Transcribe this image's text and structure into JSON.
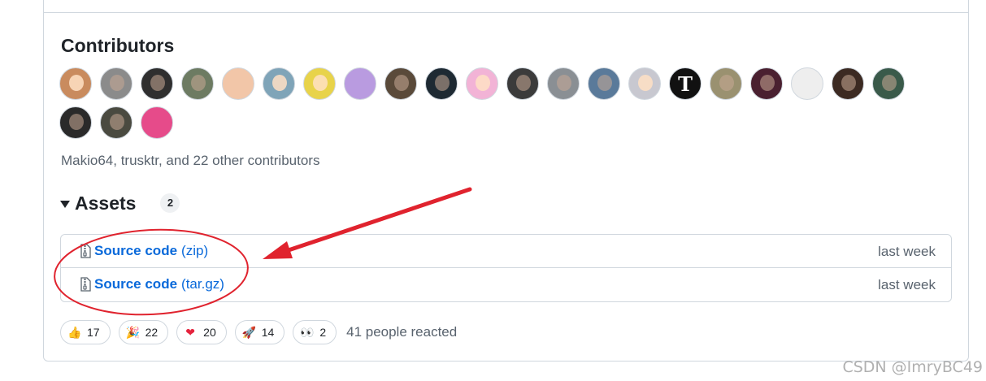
{
  "contributors": {
    "title": "Contributors",
    "summary": "Makio64, trusktr, and 22 other contributors",
    "avatars": [
      {
        "color": "#c98b5e",
        "style": "light"
      },
      {
        "color": "#8b8b8b",
        "style": "dark"
      },
      {
        "color": "#2f2f2f",
        "style": "dark"
      },
      {
        "color": "#6d7b62",
        "style": "dark"
      },
      {
        "color": "#f2c6a8",
        "style": "logo"
      },
      {
        "color": "#7fa4b8",
        "style": "light"
      },
      {
        "color": "#e8d34a",
        "style": "light"
      },
      {
        "color": "#b99be0",
        "style": "logo"
      },
      {
        "color": "#5a4a3a",
        "style": "dark"
      },
      {
        "color": "#1e2a33",
        "style": "dark"
      },
      {
        "color": "#f2b3d6",
        "style": "light"
      },
      {
        "color": "#3b3b3b",
        "style": "dark"
      },
      {
        "color": "#8a8f94",
        "style": "dark"
      },
      {
        "color": "#5a7a9a",
        "style": "dark"
      },
      {
        "color": "#c8c8d0",
        "style": "light"
      },
      {
        "color": "#111111",
        "style": "logo",
        "mark": "T"
      },
      {
        "color": "#9a9170",
        "style": "dark"
      },
      {
        "color": "#4a2030",
        "style": "dark"
      },
      {
        "color": "#eeeeee",
        "style": "logo"
      },
      {
        "color": "#3c2a22",
        "style": "dark"
      },
      {
        "color": "#3a5a4a",
        "style": "dark"
      },
      {
        "color": "#2a2a2a",
        "style": "dark"
      },
      {
        "color": "#4a4a40",
        "style": "dark"
      },
      {
        "color": "#e64b8a",
        "style": "logo"
      }
    ]
  },
  "assets": {
    "title": "Assets",
    "count": "2",
    "items": [
      {
        "name": "Source code",
        "ext": "(zip)",
        "date": "last week"
      },
      {
        "name": "Source code",
        "ext": "(tar.gz)",
        "date": "last week"
      }
    ]
  },
  "reactions": {
    "items": [
      {
        "emoji": "👍",
        "icon": "thumbs-up-icon",
        "count": "17"
      },
      {
        "emoji": "🎉",
        "icon": "party-popper-icon",
        "count": "22"
      },
      {
        "emoji": "❤",
        "icon": "heart-icon",
        "count": "20"
      },
      {
        "emoji": "🚀",
        "icon": "rocket-icon",
        "count": "14"
      },
      {
        "emoji": "👀",
        "icon": "eyes-icon",
        "count": "2"
      }
    ],
    "summary": "41 people reacted"
  },
  "annotation": {
    "color": "#e0232e"
  },
  "watermark": "CSDN @ImryBC49"
}
